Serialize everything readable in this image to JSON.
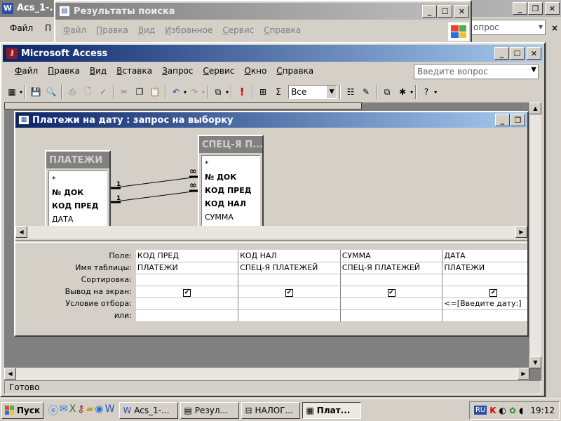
{
  "word_window": {
    "title": "Acs_1-...",
    "menu_file": "Файл",
    "menu_partial": "П",
    "ask_partial": "опрос"
  },
  "ie_window": {
    "title": "Результаты поиска",
    "menu": [
      "Файл",
      "Правка",
      "Вид",
      "Избранное",
      "Сервис",
      "Справка"
    ]
  },
  "access": {
    "title": "Microsoft Access",
    "menu": [
      "Файл",
      "Правка",
      "Вид",
      "Вставка",
      "Запрос",
      "Сервис",
      "Окно",
      "Справка"
    ],
    "ask_placeholder": "Введите вопрос",
    "top_values": "Все",
    "status": "Готово"
  },
  "query": {
    "title": "Платежи на дату : запрос на выборку",
    "table1": {
      "name": "ПЛАТЕЖИ",
      "fields": [
        "*",
        "№ ДОК",
        "КОД ПРЕД",
        "ДАТА"
      ],
      "bold": [
        false,
        true,
        true,
        false
      ]
    },
    "table2": {
      "name": "СПЕЦ-Я П...",
      "fields": [
        "*",
        "№ ДОК",
        "КОД ПРЕД",
        "КОД НАЛ",
        "СУММА"
      ],
      "bold": [
        false,
        true,
        true,
        true,
        false
      ]
    },
    "join_one": "1",
    "row_labels": [
      "Поле:",
      "Имя таблицы:",
      "Сортировка:",
      "Вывод на экран:",
      "Условие отбора:",
      "или:"
    ],
    "columns": [
      {
        "field": "КОД ПРЕД",
        "table": "ПЛАТЕЖИ",
        "sort": "",
        "show": true,
        "criteria": "",
        "or": ""
      },
      {
        "field": "КОД НАЛ",
        "table": "СПЕЦ-Я ПЛАТЕЖЕЙ",
        "sort": "",
        "show": true,
        "criteria": "",
        "or": ""
      },
      {
        "field": "СУММА",
        "table": "СПЕЦ-Я ПЛАТЕЖЕЙ",
        "sort": "",
        "show": true,
        "criteria": "",
        "or": ""
      },
      {
        "field": "ДАТА",
        "table": "ПЛАТЕЖИ",
        "sort": "",
        "show": true,
        "criteria": "<=[Введите дату:]",
        "or": ""
      }
    ]
  },
  "taskbar": {
    "start": "Пуск",
    "tasks": [
      "Acs_1-...",
      "Резул...",
      "НАЛОГ...",
      "Плат..."
    ],
    "lang": "RU",
    "clock": "19:12"
  }
}
